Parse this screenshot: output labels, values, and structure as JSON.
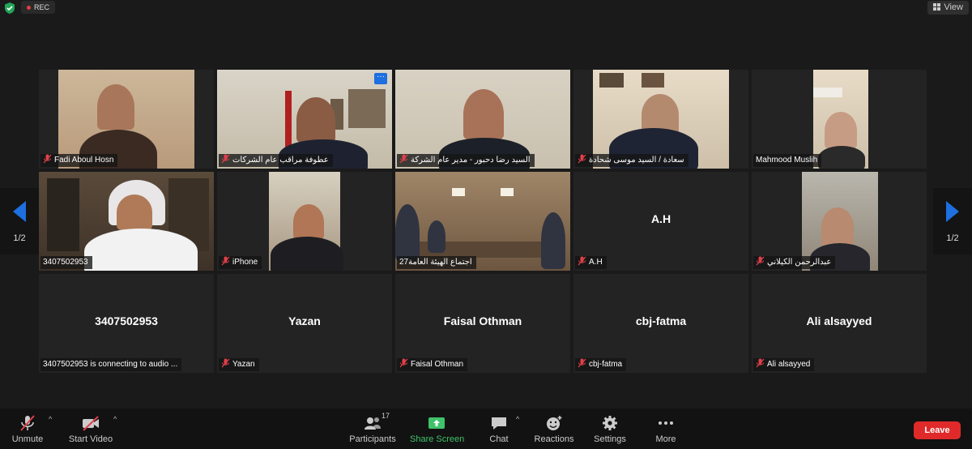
{
  "topbar": {
    "rec_label": "REC",
    "view_label": "View"
  },
  "paging": {
    "left_page": "1/2",
    "right_page": "1/2"
  },
  "participants": [
    {
      "label": "Fadi Aboul Hosn"
    },
    {
      "label": "عطوفة مراقب عام الشركات"
    },
    {
      "label": "السيد رضا دحبور - مدير عام الشركة"
    },
    {
      "label": "سعادة / السيد موسى شحادة"
    },
    {
      "label": "Mahmood Muslih"
    },
    {
      "label": "3407502953"
    },
    {
      "label": "iPhone"
    },
    {
      "label": "27اجتماع الهيئة العامة"
    },
    {
      "label": "A.H",
      "display": "A.H"
    },
    {
      "label": "عبدالرحمن الكيلاني"
    },
    {
      "label": "3407502953 is connecting to audio ...",
      "display": "3407502953"
    },
    {
      "label": "Yazan",
      "display": "Yazan"
    },
    {
      "label": "Faisal Othman",
      "display": "Faisal Othman"
    },
    {
      "label": "cbj-fatma",
      "display": "cbj-fatma"
    },
    {
      "label": "Ali alsayyed",
      "display": "Ali alsayyed"
    }
  ],
  "toolbar": {
    "unmute": "Unmute",
    "start_video": "Start Video",
    "participants": "Participants",
    "participants_count": "17",
    "share_screen": "Share Screen",
    "chat": "Chat",
    "reactions": "Reactions",
    "settings": "Settings",
    "more": "More",
    "leave": "Leave"
  },
  "colors": {
    "share_green": "#3fc26a",
    "leave_red": "#e02a2a",
    "nav_blue": "#1e6fe0",
    "mic_off_red": "#e0404a"
  }
}
